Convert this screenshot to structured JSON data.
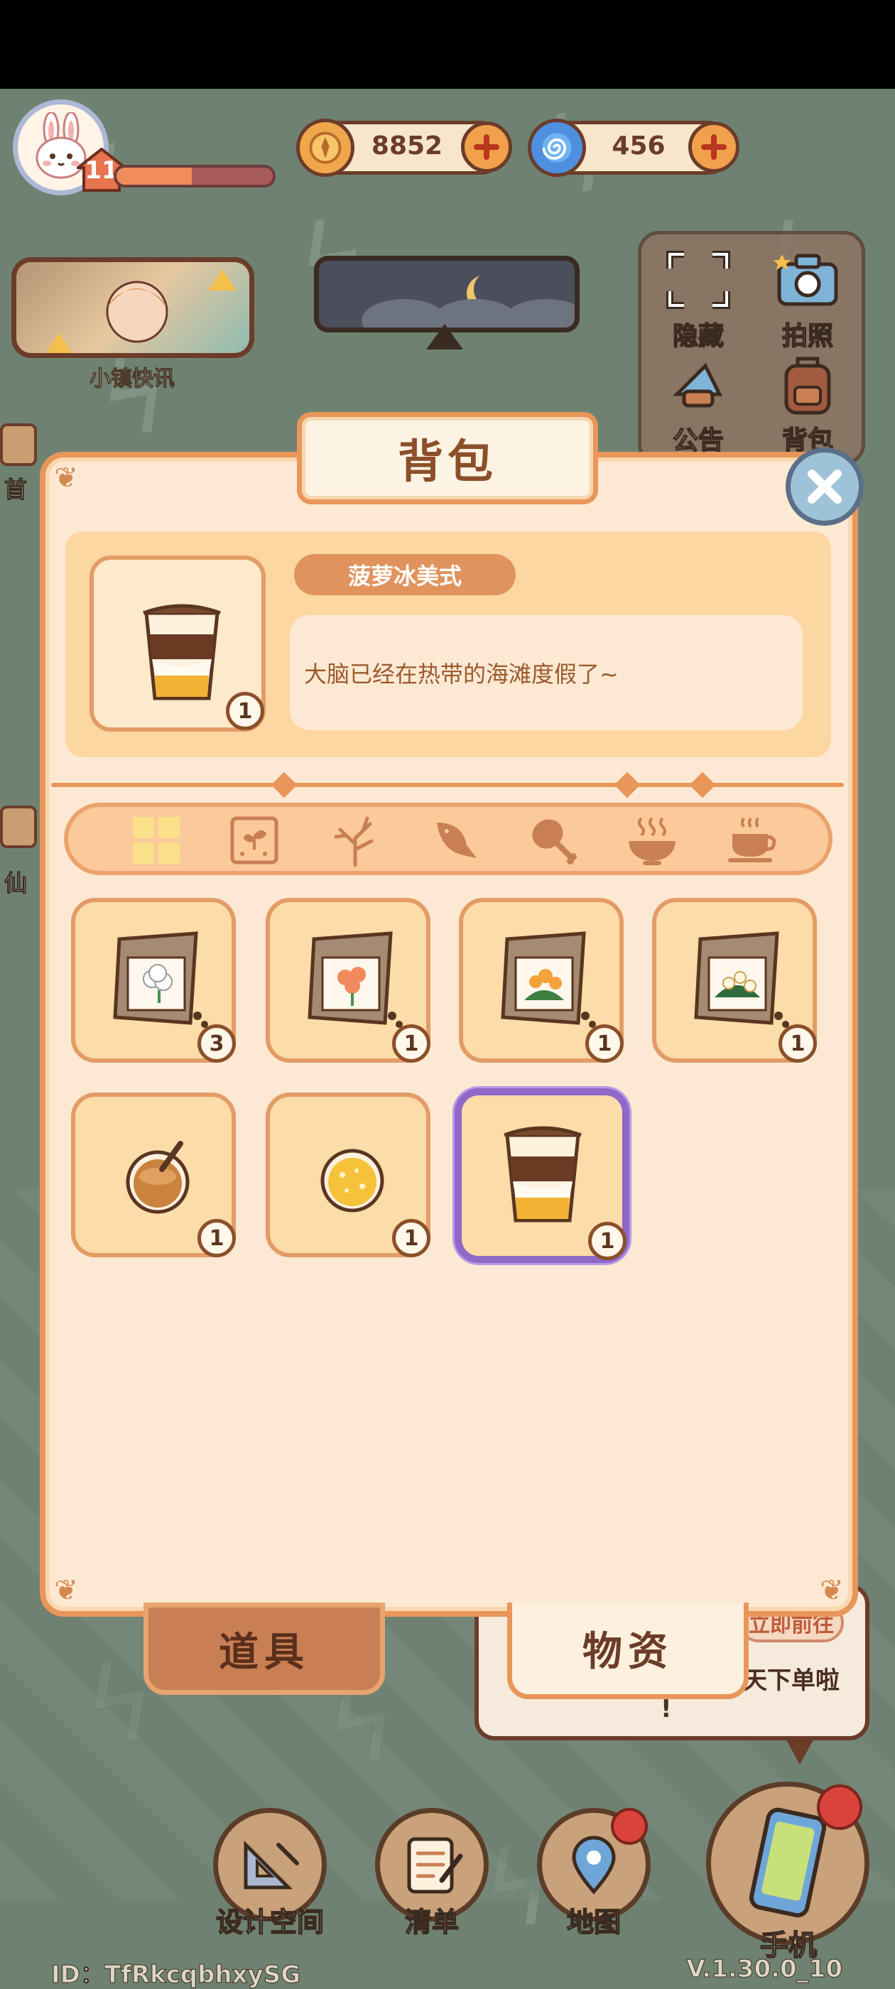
{
  "player": {
    "level": "11",
    "exp_progress": 0.48,
    "avatar_icon": "bunny-icon"
  },
  "currencies": [
    {
      "icon": "coin-icon",
      "value": "8852",
      "color": "#f0a64b"
    },
    {
      "icon": "swirl-gem-icon",
      "value": "456",
      "color": "#4f8fe0"
    }
  ],
  "hud": {
    "news_label": "小镇快讯",
    "side_buttons": [
      {
        "icon": "hide-icon",
        "label": "隐藏"
      },
      {
        "icon": "camera-icon",
        "label": "拍照"
      },
      {
        "icon": "announcement-icon",
        "label": "公告"
      },
      {
        "icon": "backpack-icon",
        "label": "背包"
      }
    ],
    "left_fragments": [
      "首",
      "仙"
    ]
  },
  "backpack": {
    "title": "背包",
    "selected_item": {
      "name": "菠萝冰美式",
      "description": "大脑已经在热带的海滩度假了~",
      "count": "1",
      "icon": "iced-coffee-icon"
    },
    "category_tabs": [
      {
        "icon": "all-grid-icon",
        "active": true
      },
      {
        "icon": "seed-packet-icon",
        "active": false
      },
      {
        "icon": "branch-icon",
        "active": false
      },
      {
        "icon": "fish-icon",
        "active": false
      },
      {
        "icon": "drumstick-icon",
        "active": false
      },
      {
        "icon": "hot-bowl-icon",
        "active": false
      },
      {
        "icon": "hot-cup-icon",
        "active": false
      }
    ],
    "items": [
      {
        "icon": "white-flower-seed-icon",
        "count": "3",
        "flower": "#ffffff"
      },
      {
        "icon": "orange-flower-seed-icon",
        "count": "1",
        "flower": "#f08a5d"
      },
      {
        "icon": "orange-bush-seed-icon",
        "count": "1",
        "flower": "#f4a23a"
      },
      {
        "icon": "white-bush-seed-icon",
        "count": "1",
        "flower": "#fff8e0"
      },
      {
        "icon": "milk-tea-icon",
        "count": "1"
      },
      {
        "icon": "lemon-drink-icon",
        "count": "1"
      },
      {
        "icon": "iced-coffee-icon",
        "count": "1",
        "selected": true
      }
    ],
    "bottom_tabs": {
      "props": "道具",
      "materials": "物资"
    }
  },
  "bubble": {
    "pill": "立即前往",
    "line1": "天下单啦",
    "line2": "!"
  },
  "bottom_nav": [
    {
      "icon": "design-space-icon",
      "label": "设计空间",
      "badge": false
    },
    {
      "icon": "list-icon",
      "label": "清单",
      "badge": false
    },
    {
      "icon": "map-pin-icon",
      "label": "地图",
      "badge": true
    },
    {
      "icon": "phone-icon",
      "label": "手机",
      "badge": true
    }
  ],
  "footer": {
    "id": "ID：TfRkcqbhxySG",
    "version": "V.1.30.0_10"
  },
  "colors": {
    "accent": "#e8965a",
    "selected_border": "#8f68c9",
    "background": "#6f8272"
  }
}
